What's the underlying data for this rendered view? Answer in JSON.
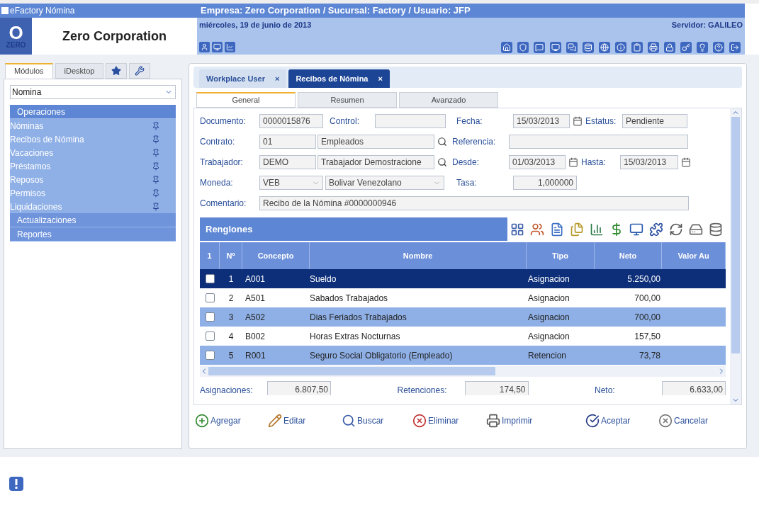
{
  "window": {
    "title": "eFactory Nómina",
    "context": "Empresa: Zero Corporation / Sucursal: Factory / Usuario: JFP"
  },
  "header": {
    "logo_letter": "O",
    "logo_text": "ZERO",
    "company": "Zero Corporation",
    "date": "miércoles, 19 de junio de 2013",
    "server": "Servidor: GALILEO"
  },
  "sidebar": {
    "tabs": [
      {
        "label": "Módulos",
        "selected": true
      },
      {
        "label": "iDesktop",
        "selected": false
      }
    ],
    "module_select": "Nomina",
    "sections": [
      {
        "label": "Operaciones",
        "expanded": true,
        "items": [
          "Nóminas",
          "Recibos de Nómina",
          "Vacaciones",
          "Préstamos",
          "Reposos",
          "Permisos",
          "Liquidaciones"
        ]
      },
      {
        "label": "Actualizaciones",
        "expanded": false
      },
      {
        "label": "Reportes",
        "expanded": false
      }
    ]
  },
  "doc_tabs": [
    {
      "label": "Workplace User",
      "selected": false,
      "close": "×"
    },
    {
      "label": "Recibos de Nómina",
      "selected": true,
      "close": "×"
    }
  ],
  "form_tabs": [
    {
      "label": "General",
      "selected": true
    },
    {
      "label": "Resumen",
      "selected": false
    },
    {
      "label": "Avanzado",
      "selected": false
    }
  ],
  "form": {
    "documento": {
      "label": "Documento:",
      "value": "0000015876"
    },
    "control": {
      "label": "Control:"
    },
    "fecha": {
      "label": "Fecha:",
      "value": "15/03/2013"
    },
    "estatus": {
      "label": "Estatus:",
      "value": "Pendiente"
    },
    "contrato": {
      "label": "Contrato:",
      "code": "01",
      "name": "Empleados"
    },
    "referencia": {
      "label": "Referencia:"
    },
    "trabajador": {
      "label": "Trabajador:",
      "code": "DEMO",
      "name": "Trabajador Demostracione"
    },
    "desde": {
      "label": "Desde:",
      "value": "01/03/2013"
    },
    "hasta": {
      "label": "Hasta:",
      "value": "15/03/2013"
    },
    "moneda": {
      "label": "Moneda:",
      "code": "VEB",
      "name": "Bolivar Venezolano"
    },
    "tasa": {
      "label": "Tasa:",
      "value": "1,000000"
    },
    "comentario": {
      "label": "Comentario:",
      "value": "Recibo de la Nómina #0000000946"
    }
  },
  "table": {
    "title": "Renglones",
    "columns": [
      "1",
      "Nº",
      "Concepto",
      "Nombre",
      "Tipo",
      "Neto",
      "Valor Au"
    ],
    "rows": [
      {
        "checked": false,
        "selected": true,
        "cells": [
          "",
          "1",
          "A001",
          "Sueldo",
          "Asignacion",
          "5.250,00"
        ]
      },
      {
        "checked": false,
        "selected": false,
        "cells": [
          "",
          "2",
          "A501",
          "Sabados Trabajados",
          "Asignacion",
          "700,00"
        ]
      },
      {
        "checked": false,
        "selected": false,
        "cells": [
          "",
          "3",
          "A502",
          "Dias Feriados Trabajados",
          "Asignacion",
          "700,00"
        ]
      },
      {
        "checked": false,
        "selected": false,
        "cells": [
          "",
          "4",
          "B002",
          "Horas Extras Nocturnas",
          "Asignacion",
          "157,50"
        ]
      },
      {
        "checked": false,
        "selected": false,
        "cells": [
          "",
          "5",
          "R001",
          "Seguro Social Obligatorio (Empleado)",
          "Retencion",
          "73,78"
        ]
      }
    ]
  },
  "totals": [
    {
      "label": "Asignaciones:",
      "value": "6.807,50"
    },
    {
      "label": "Retenciones:",
      "value": "174,50"
    },
    {
      "label": "Neto:",
      "value": "6.633,00"
    }
  ],
  "buttons": [
    "Agregar",
    "Editar",
    "Buscar",
    "Eliminar",
    "Imprimir",
    "Aceptar",
    "Cancelar"
  ]
}
